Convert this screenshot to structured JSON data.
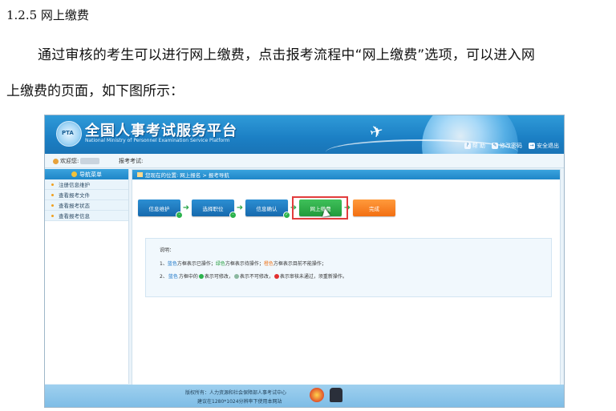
{
  "document": {
    "heading": "1.2.5 网上缴费",
    "para_line1": "通过审核的考生可以进行网上缴费，点击报考流程中“网上缴费”选项，可以进入网",
    "para_line2": "上缴费的页面，如下图所示："
  },
  "screenshot": {
    "banner": {
      "title": "全国人事考试服务平台",
      "subtitle": "National Ministry of Personnel Examination Service Platform",
      "logo_text": "PTA",
      "links": [
        {
          "icon": "help-icon",
          "label": "帮 助"
        },
        {
          "icon": "password-icon",
          "label": "修改密码"
        },
        {
          "icon": "logout-icon",
          "label": "安全退出"
        }
      ]
    },
    "infobar": {
      "welcome": "欢迎您:",
      "exam": "报考考试:"
    },
    "sidebar": {
      "header": "导航菜单",
      "items": [
        "注册信息维护",
        "查看报考文件",
        "查看报考状态",
        "查看报考信息"
      ]
    },
    "breadcrumb": "您现在的位置: 网上报名 > 报考导航",
    "steps": [
      {
        "label": "信息维护",
        "state": "done"
      },
      {
        "label": "选择职位",
        "state": "done"
      },
      {
        "label": "信息确认",
        "state": "done"
      },
      {
        "label": "网上缴费",
        "state": "current"
      },
      {
        "label": "完成",
        "state": "todo"
      }
    ],
    "note": {
      "title": "说明：",
      "line1": {
        "prefix": "1、",
        "blue_word": "蓝色",
        "part1": "方框表示已操作；",
        "green_word": "绿色",
        "part2": "方框表示待操作；",
        "orange_word": "橙色",
        "part3": "方框表示目前不能操作；"
      },
      "line2": {
        "prefix": "2、",
        "blue_word": "蓝色",
        "part1": "方框中的",
        "part2": "表示可修改，",
        "part3": "表示不可修改，",
        "part4": "表示审核未通过，须重新操作。"
      }
    },
    "footer": {
      "line1": "版权所有：人力资源和社会保障部人事考试中心",
      "line2": "建议在1280*1024分辨率下使用本网站"
    },
    "colors": {
      "done": "#1f78c8",
      "current": "#2aa043",
      "todo": "#f07820",
      "highlight": "#e23c3c"
    }
  }
}
